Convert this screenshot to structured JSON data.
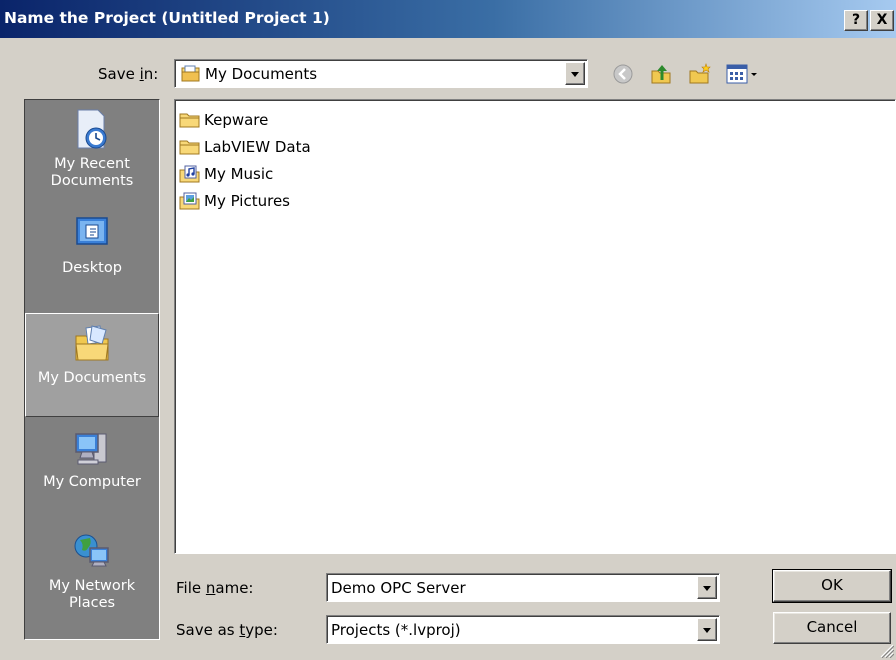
{
  "window": {
    "title": "Name the Project (Untitled Project 1)",
    "help_label": "?",
    "close_label": "X"
  },
  "save_in": {
    "label_pre": "Save ",
    "label_key": "i",
    "label_post": "n:",
    "value": "My Documents"
  },
  "places": [
    {
      "label_line1": "My Recent",
      "label_line2": "Documents",
      "icon": "recent-documents-icon"
    },
    {
      "label_line1": "Desktop",
      "label_line2": "",
      "icon": "desktop-icon"
    },
    {
      "label_line1": "My Documents",
      "label_line2": "",
      "icon": "my-documents-icon",
      "selected": true
    },
    {
      "label_line1": "My Computer",
      "label_line2": "",
      "icon": "my-computer-icon"
    },
    {
      "label_line1": "My Network",
      "label_line2": "Places",
      "icon": "network-places-icon"
    }
  ],
  "files": [
    {
      "name": "Kepware",
      "icon": "folder-icon"
    },
    {
      "name": "LabVIEW Data",
      "icon": "folder-icon"
    },
    {
      "name": "My Music",
      "icon": "music-folder-icon"
    },
    {
      "name": "My Pictures",
      "icon": "pictures-folder-icon"
    }
  ],
  "file_name": {
    "label_pre": "File ",
    "label_key": "n",
    "label_post": "ame:",
    "value": "Demo OPC Server"
  },
  "save_as_type": {
    "label_pre": "Save as ",
    "label_key": "t",
    "label_post": "ype:",
    "value": "Projects (*.lvproj)"
  },
  "buttons": {
    "ok": "OK",
    "cancel": "Cancel"
  },
  "colors": {
    "title_gradient_start": "#0a246a",
    "title_gradient_end": "#a6caf0",
    "face": "#d4d0c8",
    "places_bg": "#808080"
  }
}
